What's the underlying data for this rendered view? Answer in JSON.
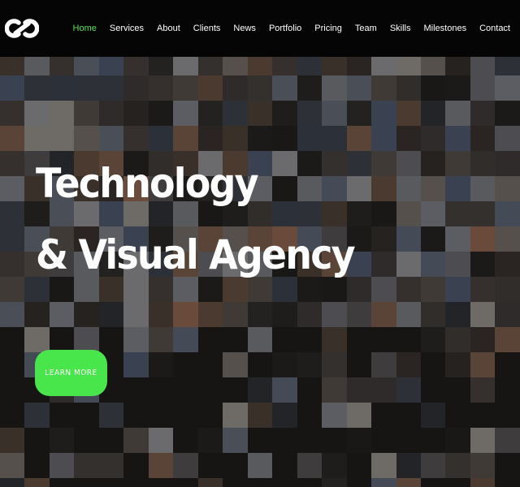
{
  "brand": {
    "logo_icon": "infinity-link-icon"
  },
  "nav": {
    "items": [
      {
        "label": "Home",
        "active": true
      },
      {
        "label": "Services",
        "active": false
      },
      {
        "label": "About",
        "active": false
      },
      {
        "label": "Clients",
        "active": false
      },
      {
        "label": "News",
        "active": false
      },
      {
        "label": "Portfolio",
        "active": false
      },
      {
        "label": "Pricing",
        "active": false
      },
      {
        "label": "Team",
        "active": false
      },
      {
        "label": "Skills",
        "active": false
      },
      {
        "label": "Milestones",
        "active": false
      },
      {
        "label": "Contact",
        "active": false
      }
    ],
    "active_color": "#4ee44e"
  },
  "hero": {
    "line1": "Technology",
    "line2": "& Visual Agency",
    "cta_label": "LEARN MORE",
    "cta_color": "#48e64a"
  }
}
